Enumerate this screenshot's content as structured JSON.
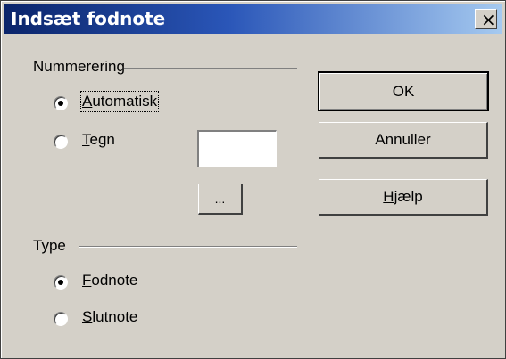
{
  "window": {
    "title": "Indsæt fodnote",
    "close_glyph": "×"
  },
  "numbering": {
    "heading": "Nummerering",
    "options": [
      {
        "label": "Automatisk",
        "mnemonic": "A",
        "rest": "utomatisk",
        "checked": true
      },
      {
        "label": "Tegn",
        "mnemonic": "T",
        "rest": "egn",
        "checked": false
      }
    ],
    "char_value": "",
    "browse_label": "..."
  },
  "type": {
    "heading": "Type",
    "options": [
      {
        "label": "Fodnote",
        "mnemonic": "F",
        "rest": "odnote",
        "checked": true
      },
      {
        "label": "Slutnote",
        "mnemonic": "S",
        "rest": "lutnote",
        "checked": false
      }
    ]
  },
  "buttons": {
    "ok": "OK",
    "cancel": "Annuller",
    "help": {
      "label": "Hjælp",
      "mnemonic": "H",
      "rest": "jælp"
    }
  }
}
